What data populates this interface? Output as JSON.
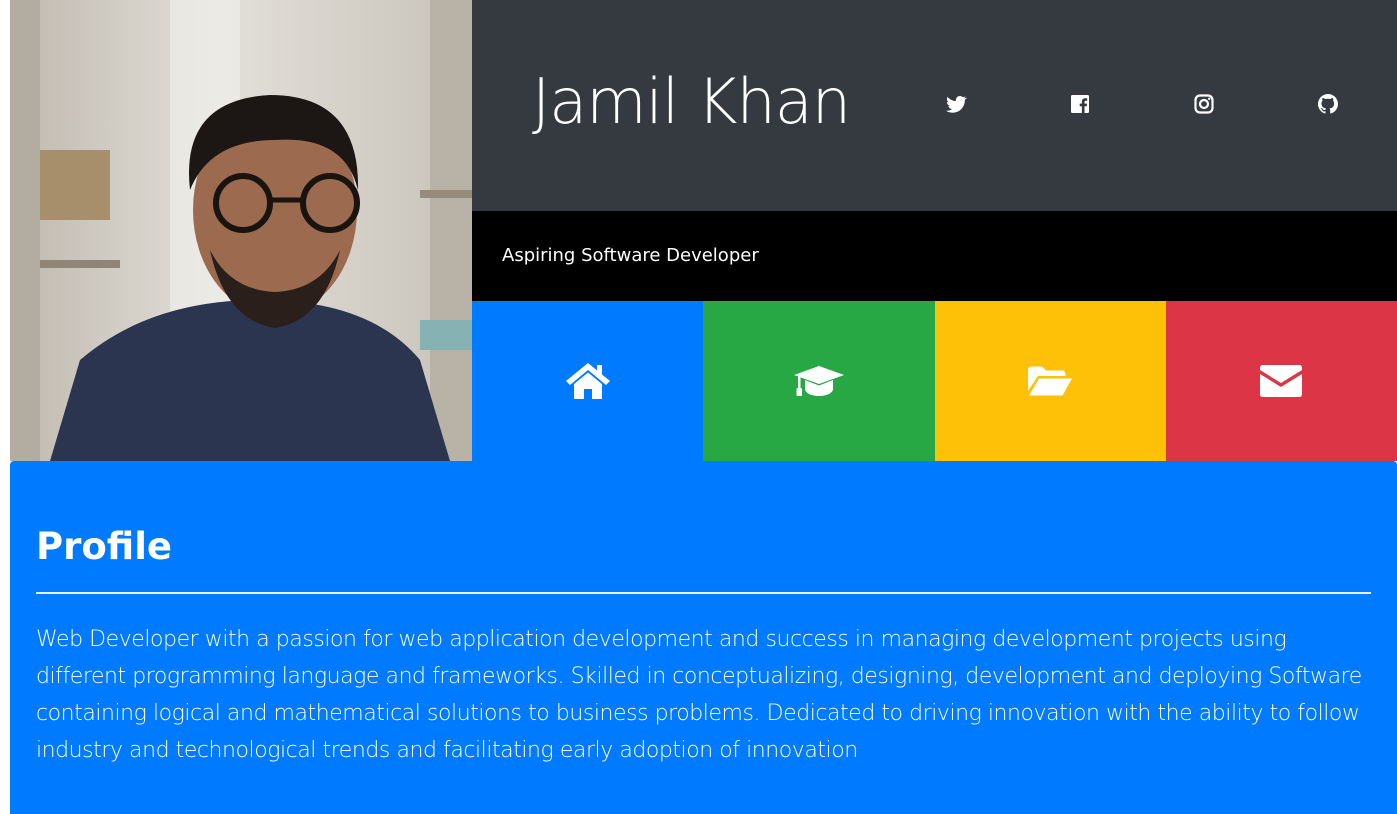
{
  "header": {
    "name": "Jamil Khan",
    "tagline": "Aspiring Software Developer",
    "background_color": "#343a40",
    "tagline_background_color": "#000000"
  },
  "social": [
    {
      "icon": "twitter-icon"
    },
    {
      "icon": "facebook-icon"
    },
    {
      "icon": "instagram-icon"
    },
    {
      "icon": "github-icon"
    }
  ],
  "nav_tiles": [
    {
      "icon": "home-icon",
      "color": "#007bff"
    },
    {
      "icon": "graduation-cap-icon",
      "color": "#28a745"
    },
    {
      "icon": "folder-open-icon",
      "color": "#ffc107"
    },
    {
      "icon": "envelope-icon",
      "color": "#dc3545"
    }
  ],
  "profile": {
    "heading": "Profile",
    "body": "Web Developer with a passion for web application development and success in managing development projects using different programming language and frameworks. Skilled in conceptualizing, designing, development and deploying Software containing logical and mathematical solutions to business problems. Dedicated to driving innovation with the ability to follow industry and technological trends and facilitating early adoption of innovation",
    "background_color": "#007bff"
  }
}
